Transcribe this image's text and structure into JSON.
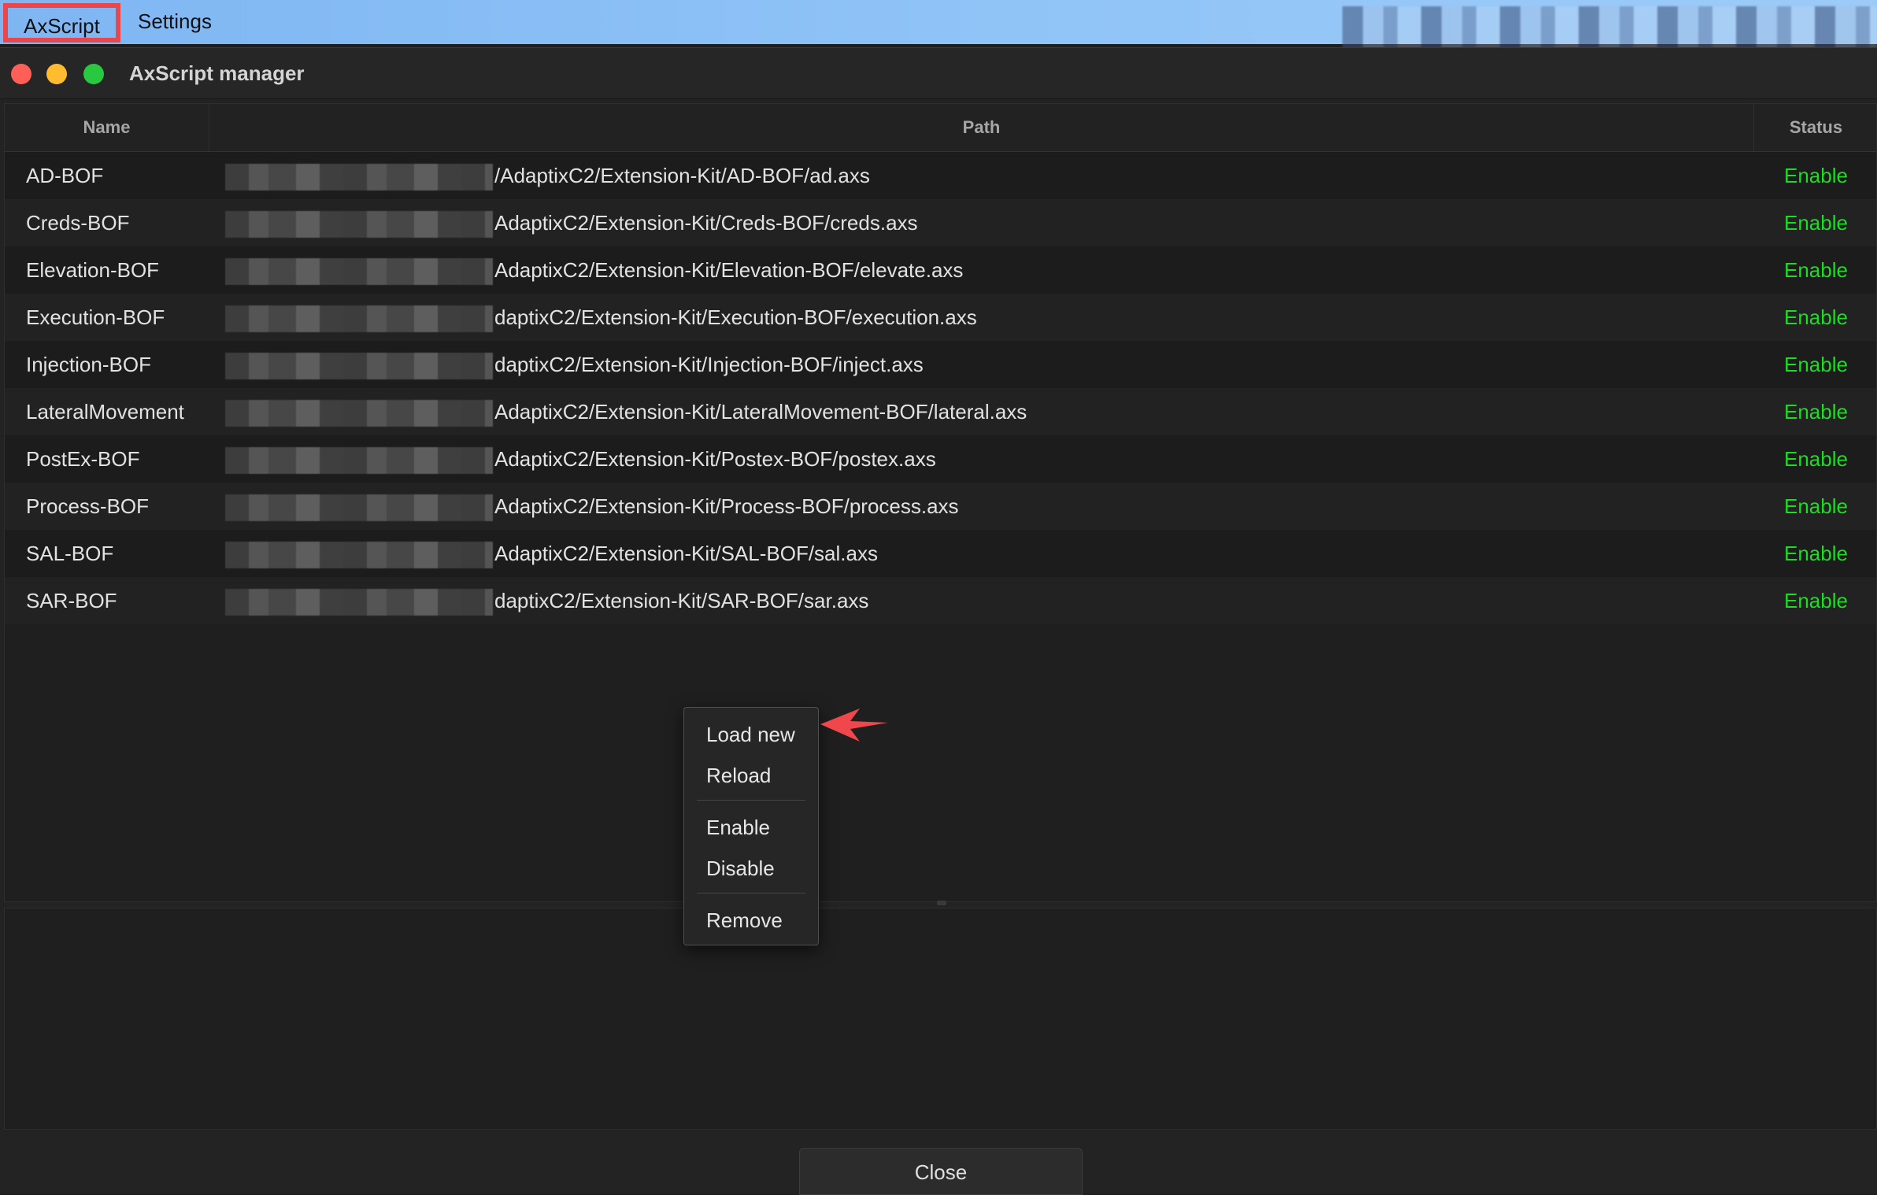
{
  "menubar": {
    "items": [
      {
        "label": "AxScript"
      },
      {
        "label": "Settings"
      }
    ]
  },
  "window": {
    "title": "AxScript manager"
  },
  "table": {
    "columns": [
      "Name",
      "Path",
      "Status"
    ],
    "rows": [
      {
        "name": "AD-BOF",
        "path": "/AdaptixC2/Extension-Kit/AD-BOF/ad.axs",
        "status": "Enable"
      },
      {
        "name": "Creds-BOF",
        "path": "AdaptixC2/Extension-Kit/Creds-BOF/creds.axs",
        "status": "Enable"
      },
      {
        "name": "Elevation-BOF",
        "path": "AdaptixC2/Extension-Kit/Elevation-BOF/elevate.axs",
        "status": "Enable"
      },
      {
        "name": "Execution-BOF",
        "path": "daptixC2/Extension-Kit/Execution-BOF/execution.axs",
        "status": "Enable"
      },
      {
        "name": "Injection-BOF",
        "path": "daptixC2/Extension-Kit/Injection-BOF/inject.axs",
        "status": "Enable"
      },
      {
        "name": "LateralMovement",
        "path": "AdaptixC2/Extension-Kit/LateralMovement-BOF/lateral.axs",
        "status": "Enable"
      },
      {
        "name": "PostEx-BOF",
        "path": "AdaptixC2/Extension-Kit/Postex-BOF/postex.axs",
        "status": "Enable"
      },
      {
        "name": "Process-BOF",
        "path": "AdaptixC2/Extension-Kit/Process-BOF/process.axs",
        "status": "Enable"
      },
      {
        "name": "SAL-BOF",
        "path": "AdaptixC2/Extension-Kit/SAL-BOF/sal.axs",
        "status": "Enable"
      },
      {
        "name": "SAR-BOF",
        "path": "daptixC2/Extension-Kit/SAR-BOF/sar.axs",
        "status": "Enable"
      }
    ]
  },
  "context_menu": {
    "items": [
      "Load new",
      "Reload",
      "Enable",
      "Disable",
      "Remove"
    ]
  },
  "footer": {
    "close_label": "Close"
  },
  "colors": {
    "status_enabled": "#1ddc24",
    "highlight_box": "#e7474d",
    "arrow": "#f0474d"
  }
}
